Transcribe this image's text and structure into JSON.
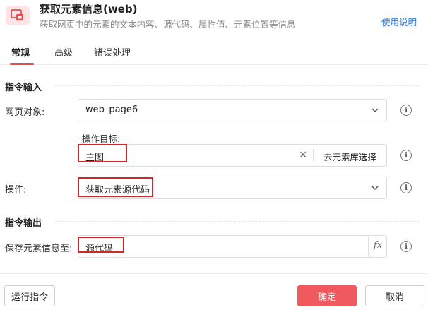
{
  "header": {
    "title": "获取元素信息(web)",
    "subtitle": "获取网页中的元素的文本内容、源代码、属性值、元素位置等信息",
    "help_link": "使用说明",
    "icon": "web-element-icon"
  },
  "tabs": [
    {
      "label": "常规",
      "active": true
    },
    {
      "label": "高级",
      "active": false
    },
    {
      "label": "错误处理",
      "active": false
    }
  ],
  "input_section": {
    "title": "指令输入",
    "web_page": {
      "label": "网页对象:",
      "value": "web_page6"
    },
    "target": {
      "label": "操作目标:",
      "value": "主图",
      "library_button": "去元素库选择"
    },
    "operation": {
      "label": "操作:",
      "value": "获取元素源代码"
    }
  },
  "output_section": {
    "title": "指令输出",
    "save_to": {
      "label": "保存元素信息至:",
      "value": "源代码"
    }
  },
  "footer": {
    "run_button": "运行指令",
    "ok_button": "确定",
    "cancel_button": "取消"
  },
  "colors": {
    "accent": "#f05a5e",
    "link": "#2f7de1",
    "highlight_outline": "#d6262d"
  }
}
